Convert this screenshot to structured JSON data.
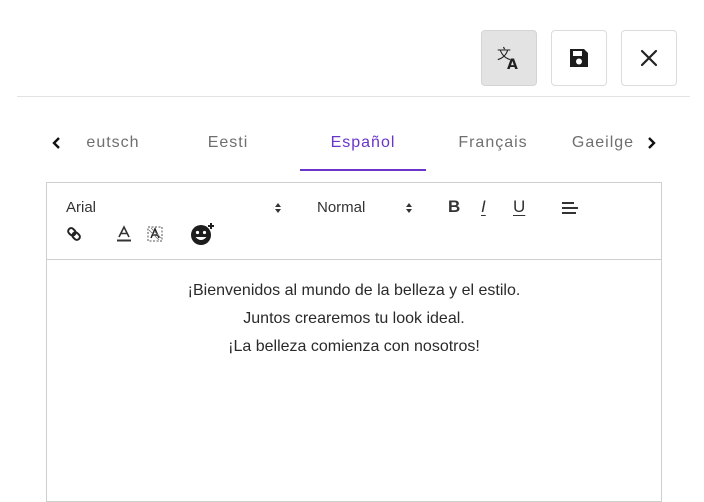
{
  "toolbar_top": {
    "translate_icon": "translate-icon",
    "save_icon": "floppy-disk-icon",
    "close_icon": "close-icon",
    "translate_active": true
  },
  "language_tabs": {
    "items": [
      {
        "label": "eutsch",
        "active": false
      },
      {
        "label": "Eesti",
        "active": false
      },
      {
        "label": "Español",
        "active": true
      },
      {
        "label": "Français",
        "active": false
      },
      {
        "label": "Gaeilge",
        "active": false
      }
    ],
    "prev_icon": "chevron-left-icon",
    "next_icon": "chevron-right-icon",
    "accent_color": "#6a35c9"
  },
  "editor": {
    "font_family_value": "Arial",
    "font_size_value": "Normal",
    "bold_label": "B",
    "italic_label": "I",
    "underline_label": "U",
    "align_icon": "align-left-icon",
    "link_icon": "link-icon",
    "text_color_icon": "text-color-icon",
    "background_color_icon": "highlight-icon",
    "emoji_icon": "emoji-add-icon",
    "lines": [
      "¡Bienvenidos al mundo de la belleza y el estilo.",
      "Juntos crearemos tu look ideal.",
      "¡La belleza comienza con nosotros!"
    ]
  }
}
